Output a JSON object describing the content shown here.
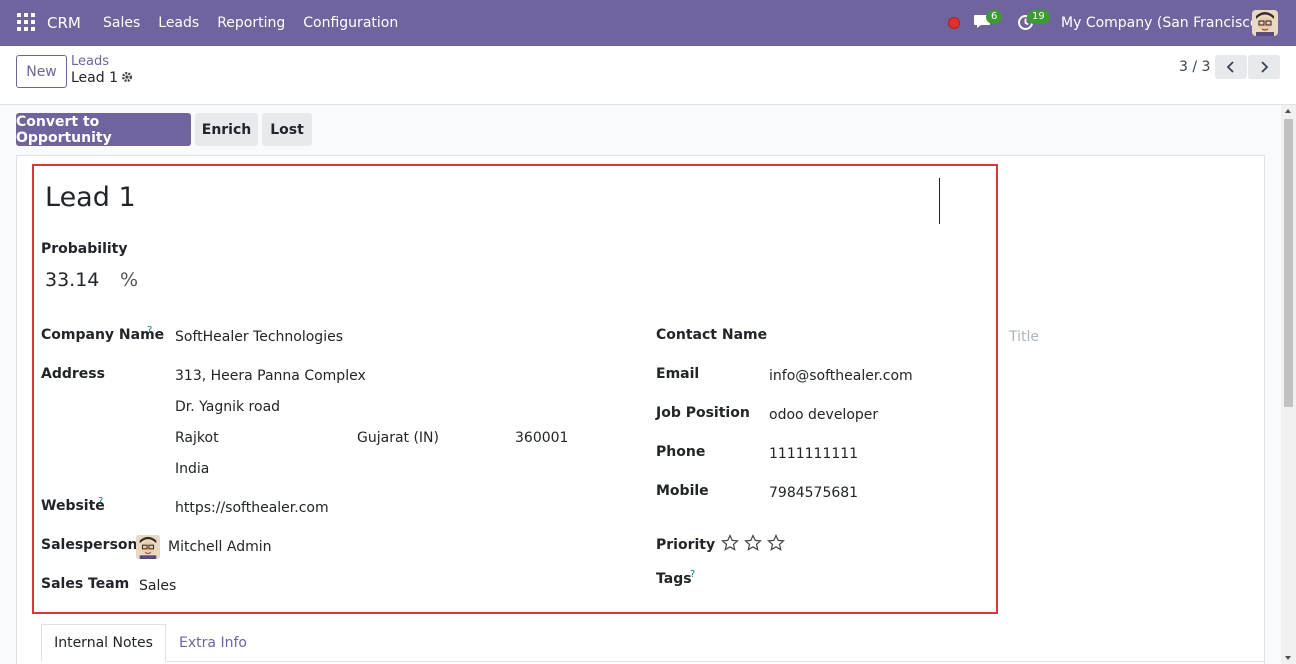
{
  "navbar": {
    "app_name": "CRM",
    "menu": [
      "Sales",
      "Leads",
      "Reporting",
      "Configuration"
    ],
    "messages_count": "6",
    "activities_count": "19",
    "company": "My Company (San Francisco)"
  },
  "control_panel": {
    "new_label": "New",
    "breadcrumb_parent": "Leads",
    "breadcrumb_current": "Lead 1",
    "pager": "3 / 3"
  },
  "actions": {
    "convert": "Convert to Opportunity",
    "enrich": "Enrich",
    "lost": "Lost"
  },
  "form": {
    "title": "Lead 1",
    "probability_label": "Probability",
    "probability_value": "33.14",
    "probability_unit": "%",
    "company_name_label": "Company Name",
    "company_name": "SoftHealer Technologies",
    "address_label": "Address",
    "street": "313, Heera Panna Complex",
    "street2": "Dr. Yagnik road",
    "city": "Rajkot",
    "state": "Gujarat (IN)",
    "zip": "360001",
    "country": "India",
    "website_label": "Website",
    "website": "https://softhealer.com",
    "salesperson_label": "Salesperson",
    "salesperson": "Mitchell Admin",
    "sales_team_label": "Sales Team",
    "sales_team": "Sales",
    "contact_name_label": "Contact Name",
    "title_placeholder": "Title",
    "email_label": "Email",
    "email": "info@softhealer.com",
    "job_position_label": "Job Position",
    "job_position": "odoo developer",
    "phone_label": "Phone",
    "phone": "1111111111",
    "mobile_label": "Mobile",
    "mobile": "7984575681",
    "priority_label": "Priority",
    "priority_value": 0,
    "priority_max": 3,
    "tags_label": "Tags",
    "help_mark": "?"
  },
  "tabs": [
    "Internal Notes",
    "Extra Info"
  ],
  "colors": {
    "brand": "#71639e",
    "highlight_border": "#d9363e",
    "badge": "#3d9a35"
  }
}
